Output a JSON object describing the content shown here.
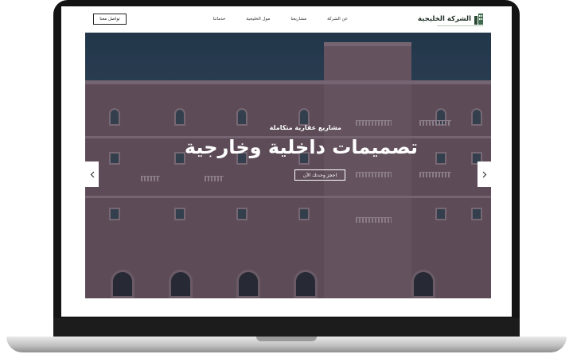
{
  "header": {
    "logo_text": "الشركة الخليجية",
    "nav": [
      "عن الشركة",
      "مشاريعنا",
      "مول الخليجية",
      "خدماتنا"
    ],
    "contact_button": "تواصل معنا"
  },
  "hero": {
    "eyebrow": "مشاريع عقارية متكاملة",
    "headline": "تصميمات داخلية وخارجية",
    "book_button": "احجز وحدتك الآن"
  },
  "icons": {
    "logo": "building-icon",
    "prev": "chevron-left-icon",
    "next": "chevron-right-icon"
  },
  "colors": {
    "brand": "#1f2f25",
    "sky": "#263f55",
    "facade": "#6d5a66"
  }
}
